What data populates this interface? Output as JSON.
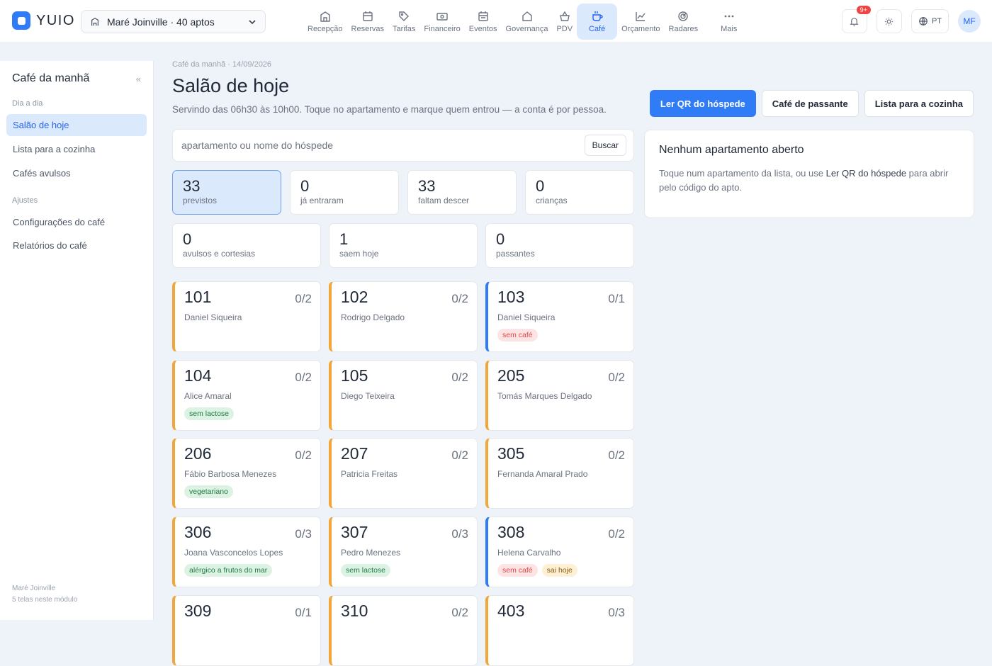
{
  "app": {
    "logo": "YUIO",
    "property": "Maré Joinville · 40 aptos"
  },
  "nav": [
    {
      "label": "Recepção",
      "icon": "reception-icon"
    },
    {
      "label": "Reservas",
      "icon": "calendar-icon"
    },
    {
      "label": "Tarifas",
      "icon": "tag-icon"
    },
    {
      "label": "Financeiro",
      "icon": "cash-icon"
    },
    {
      "label": "Eventos",
      "icon": "event-icon"
    },
    {
      "label": "Governança",
      "icon": "house-icon"
    },
    {
      "label": "PDV",
      "icon": "basket-icon"
    },
    {
      "label": "Café",
      "icon": "coffee-icon",
      "active": true
    },
    {
      "label": "Orçamento",
      "icon": "chart-line-icon"
    },
    {
      "label": "Radares",
      "icon": "radar-icon"
    },
    {
      "label": "Mais",
      "icon": "more-icon"
    }
  ],
  "topright": {
    "notif_badge": "9+",
    "lang": "PT",
    "avatar": "MF"
  },
  "sidebar": {
    "title": "Café da manhã",
    "collapse": "«",
    "section1": "Dia a dia",
    "items1": [
      "Salão de hoje",
      "Lista para a cozinha",
      "Cafés avulsos"
    ],
    "section2": "Ajustes",
    "items2": [
      "Configurações do café",
      "Relatórios do café"
    ],
    "footer1": "Maré Joinville",
    "footer2": "5 telas neste módulo"
  },
  "main": {
    "breadcrumb": "Café da manhã · 14/09/2026",
    "title": "Salão de hoje",
    "subtitle": "Servindo das 06h30 às 10h00. Toque no apartamento e marque quem entrou — a conta é por pessoa.",
    "actions": {
      "qr": "Ler QR do hóspede",
      "walkin": "Café de passante",
      "kitchen": "Lista para a cozinha"
    },
    "search": {
      "placeholder": "apartamento ou nome do hóspede",
      "button": "Buscar"
    },
    "stats_row1": [
      {
        "num": "33",
        "label": "previstos"
      },
      {
        "num": "0",
        "label": "já entraram"
      },
      {
        "num": "33",
        "label": "faltam descer"
      },
      {
        "num": "0",
        "label": "crianças"
      }
    ],
    "stats_row2": [
      {
        "num": "0",
        "label": "avulsos e cortesias"
      },
      {
        "num": "1",
        "label": "saem hoje"
      },
      {
        "num": "0",
        "label": "passantes"
      }
    ],
    "rooms": [
      {
        "num": "101",
        "count": "0/2",
        "guest": "Daniel Siqueira",
        "tags": []
      },
      {
        "num": "102",
        "count": "0/2",
        "guest": "Rodrigo Delgado",
        "tags": []
      },
      {
        "num": "103",
        "count": "0/1",
        "guest": "Daniel Siqueira",
        "tags": [
          {
            "text": "sem café",
            "kind": "red"
          }
        ]
      },
      {
        "num": "104",
        "count": "0/2",
        "guest": "Alice Amaral",
        "tags": [
          {
            "text": "sem lactose",
            "kind": "green"
          }
        ]
      },
      {
        "num": "105",
        "count": "0/2",
        "guest": "Diego Teixeira",
        "tags": []
      },
      {
        "num": "205",
        "count": "0/2",
        "guest": "Tomás Marques Delgado",
        "tags": []
      },
      {
        "num": "206",
        "count": "0/2",
        "guest": "Fábio Barbosa Menezes",
        "tags": [
          {
            "text": "vegetariano",
            "kind": "green"
          }
        ]
      },
      {
        "num": "207",
        "count": "0/2",
        "guest": "Patricia Freitas",
        "tags": []
      },
      {
        "num": "305",
        "count": "0/2",
        "guest": "Fernanda Amaral Prado",
        "tags": []
      },
      {
        "num": "306",
        "count": "0/3",
        "guest": "Joana Vasconcelos Lopes",
        "tags": [
          {
            "text": "alérgico a frutos do mar",
            "kind": "green"
          }
        ]
      },
      {
        "num": "307",
        "count": "0/3",
        "guest": "Pedro Menezes",
        "tags": [
          {
            "text": "sem lactose",
            "kind": "green"
          }
        ]
      },
      {
        "num": "308",
        "count": "0/2",
        "guest": "Helena Carvalho",
        "tags": [
          {
            "text": "sem café",
            "kind": "red"
          },
          {
            "text": "sai hoje",
            "kind": "yellow"
          }
        ]
      },
      {
        "num": "309",
        "count": "0/1",
        "guest": "",
        "tags": []
      },
      {
        "num": "310",
        "count": "0/2",
        "guest": "",
        "tags": []
      },
      {
        "num": "403",
        "count": "0/3",
        "guest": "",
        "tags": []
      }
    ],
    "panel": {
      "title": "Nenhum apartamento aberto",
      "text_before": "Toque num apartamento da lista, ou use ",
      "text_bold": "Ler QR do hóspede",
      "text_after": " para abrir pelo código do apto."
    }
  },
  "colors": {
    "accent": "#2f7cf6",
    "room_default": "#f0a63a",
    "room_no_coffee": "#2f7cf6"
  }
}
